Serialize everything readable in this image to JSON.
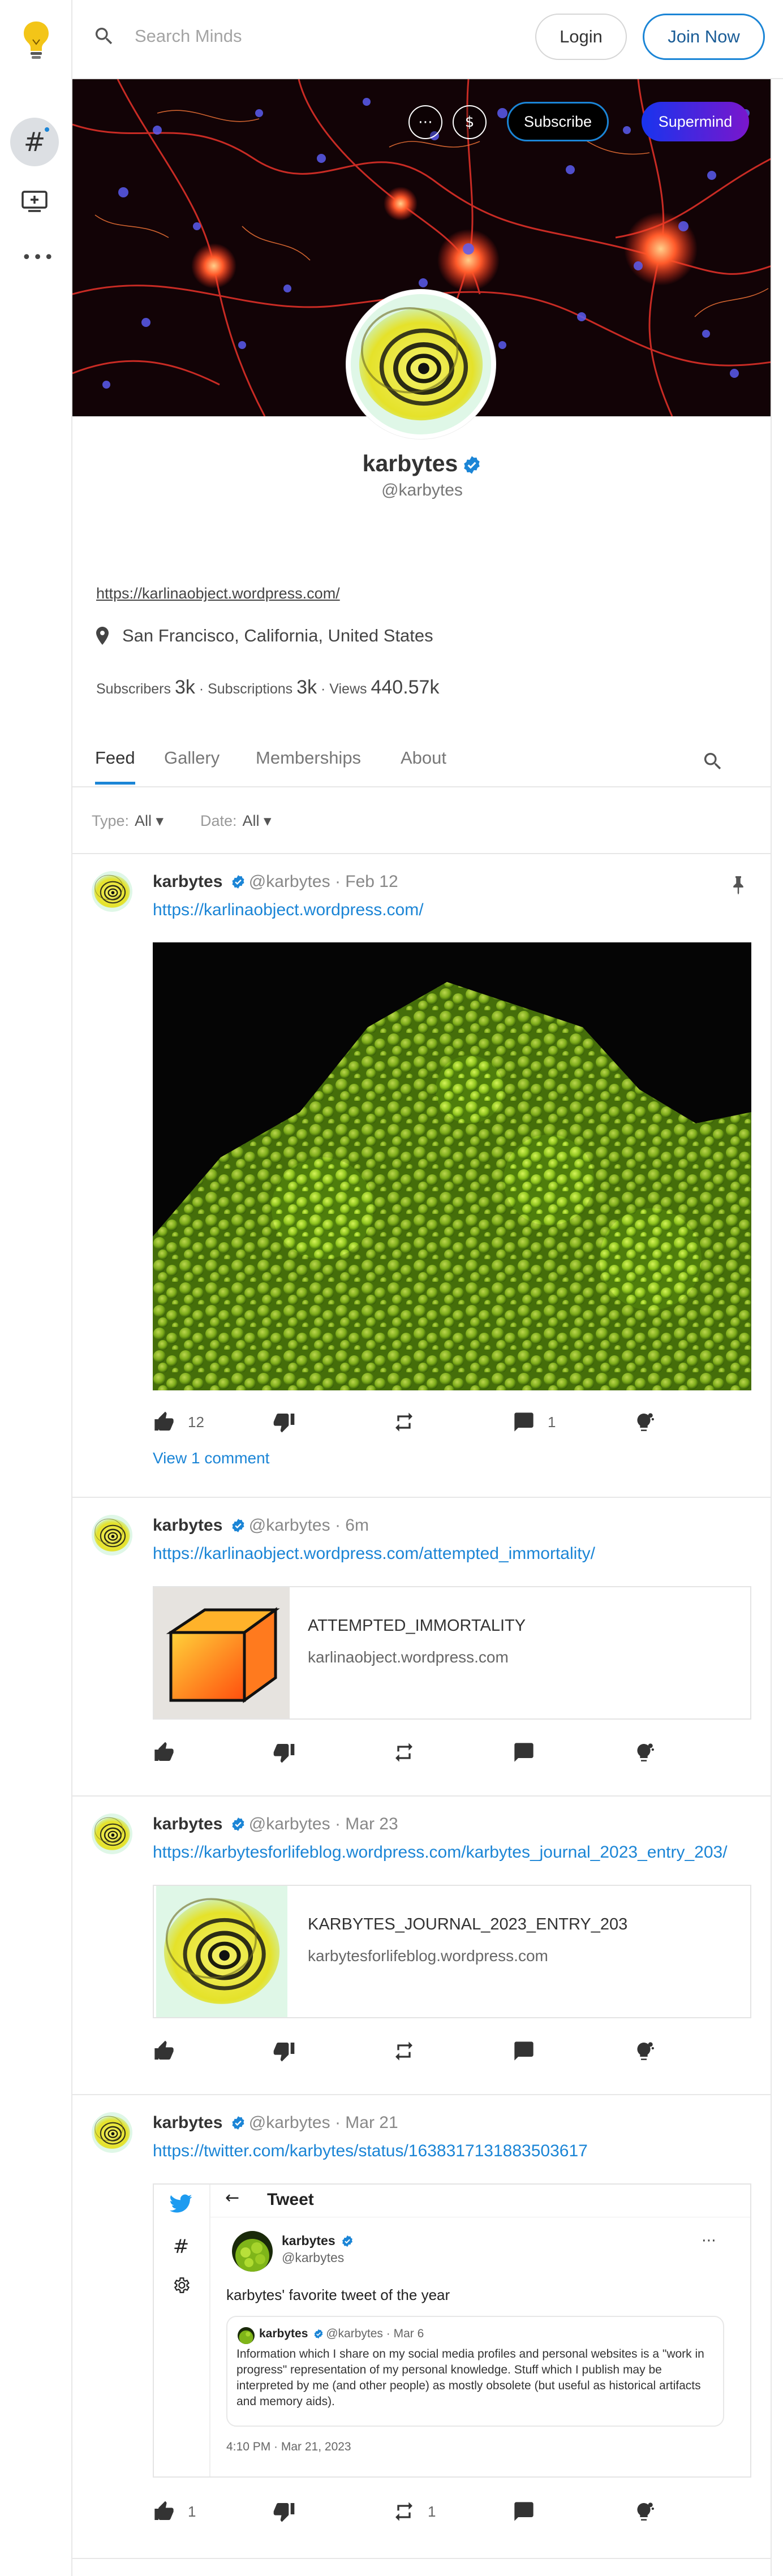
{
  "topbar": {
    "search_placeholder": "Search Minds",
    "login_label": "Login",
    "join_label": "Join Now"
  },
  "banner": {
    "more_icon": "⋯",
    "tip_icon": "$",
    "subscribe_label": "Subscribe",
    "supermind_label": "Supermind"
  },
  "profile": {
    "name": "karbytes",
    "handle": "@karbytes",
    "link": "https://karlinaobject.wordpress.com/",
    "location": "San Francisco, California, United States",
    "stats": {
      "subscribers_label": "Subscribers",
      "subscribers": "3k",
      "subscriptions_label": "Subscriptions",
      "subscriptions": "3k",
      "views_label": "Views",
      "views": "440.57k",
      "sep": " · "
    }
  },
  "tabs": [
    "Feed",
    "Gallery",
    "Memberships",
    "About"
  ],
  "active_tab": "Feed",
  "filters": {
    "type_label": "Type:",
    "type_value": "All ▾",
    "date_label": "Date:",
    "date_value": "All ▾"
  },
  "posts": [
    {
      "name": "karbytes",
      "handle": "@karbytes",
      "time": "Feb 12",
      "link": "https://karlinaobject.wordpress.com/",
      "pinned": true,
      "upvotes": "12",
      "reminds": "",
      "comments": "1",
      "view_comments": "View 1 comment"
    },
    {
      "name": "karbytes",
      "handle": "@karbytes",
      "time": "6m",
      "link": "https://karlinaobject.wordpress.com/attempted_immortality/",
      "card_title": "ATTEMPTED_IMMORTALITY",
      "card_domain": "karlinaobject.wordpress.com",
      "upvotes": "",
      "reminds": "",
      "comments": ""
    },
    {
      "name": "karbytes",
      "handle": "@karbytes",
      "time": "Mar 23",
      "link": "https://karbytesforlifeblog.wordpress.com/karbytes_journal_2023_entry_203/",
      "card_title": "KARBYTES_JOURNAL_2023_ENTRY_203",
      "card_domain": "karbytesforlifeblog.wordpress.com",
      "upvotes": "",
      "reminds": "",
      "comments": ""
    },
    {
      "name": "karbytes",
      "handle": "@karbytes",
      "time": "Mar 21",
      "link": "https://twitter.com/karbytes/status/1638317131883503617",
      "upvotes": "1",
      "reminds": "1",
      "comments": "",
      "tweet": {
        "header": "Tweet",
        "back": "←",
        "name": "karbytes",
        "handle": "@karbytes",
        "menu": "⋯",
        "text": "karbytes' favorite tweet of the year",
        "quote_name": "karbytes",
        "quote_meta": "@karbytes · Mar 6",
        "quote_text": "Information which I share on my social media profiles and personal websites is a \"work in progress\" representation of my personal knowledge. Stuff which I publish may be interpreted by me (and other people) as mostly obsolete (but useful as historical artifacts and memory aids).",
        "timestamp": "4:10 PM · Mar 21, 2023",
        "rail_hash": "#"
      }
    }
  ],
  "colors": {
    "accent": "#1b85d6",
    "border": "#e7e7e7",
    "supermind_start": "#1834ee",
    "supermind_end": "#7a16cc"
  },
  "icons": [
    "minds-bulb-logo",
    "hash-icon",
    "boost-icon",
    "more-icon",
    "search-icon",
    "location-pin-icon",
    "thumb-up-icon",
    "thumb-down-icon",
    "remind-icon",
    "comment-icon",
    "supermind-icon",
    "pin-icon",
    "verified-badge-icon",
    "twitter-bird-icon",
    "gear-icon"
  ],
  "rail": {
    "more": "•••",
    "hash": "#"
  }
}
